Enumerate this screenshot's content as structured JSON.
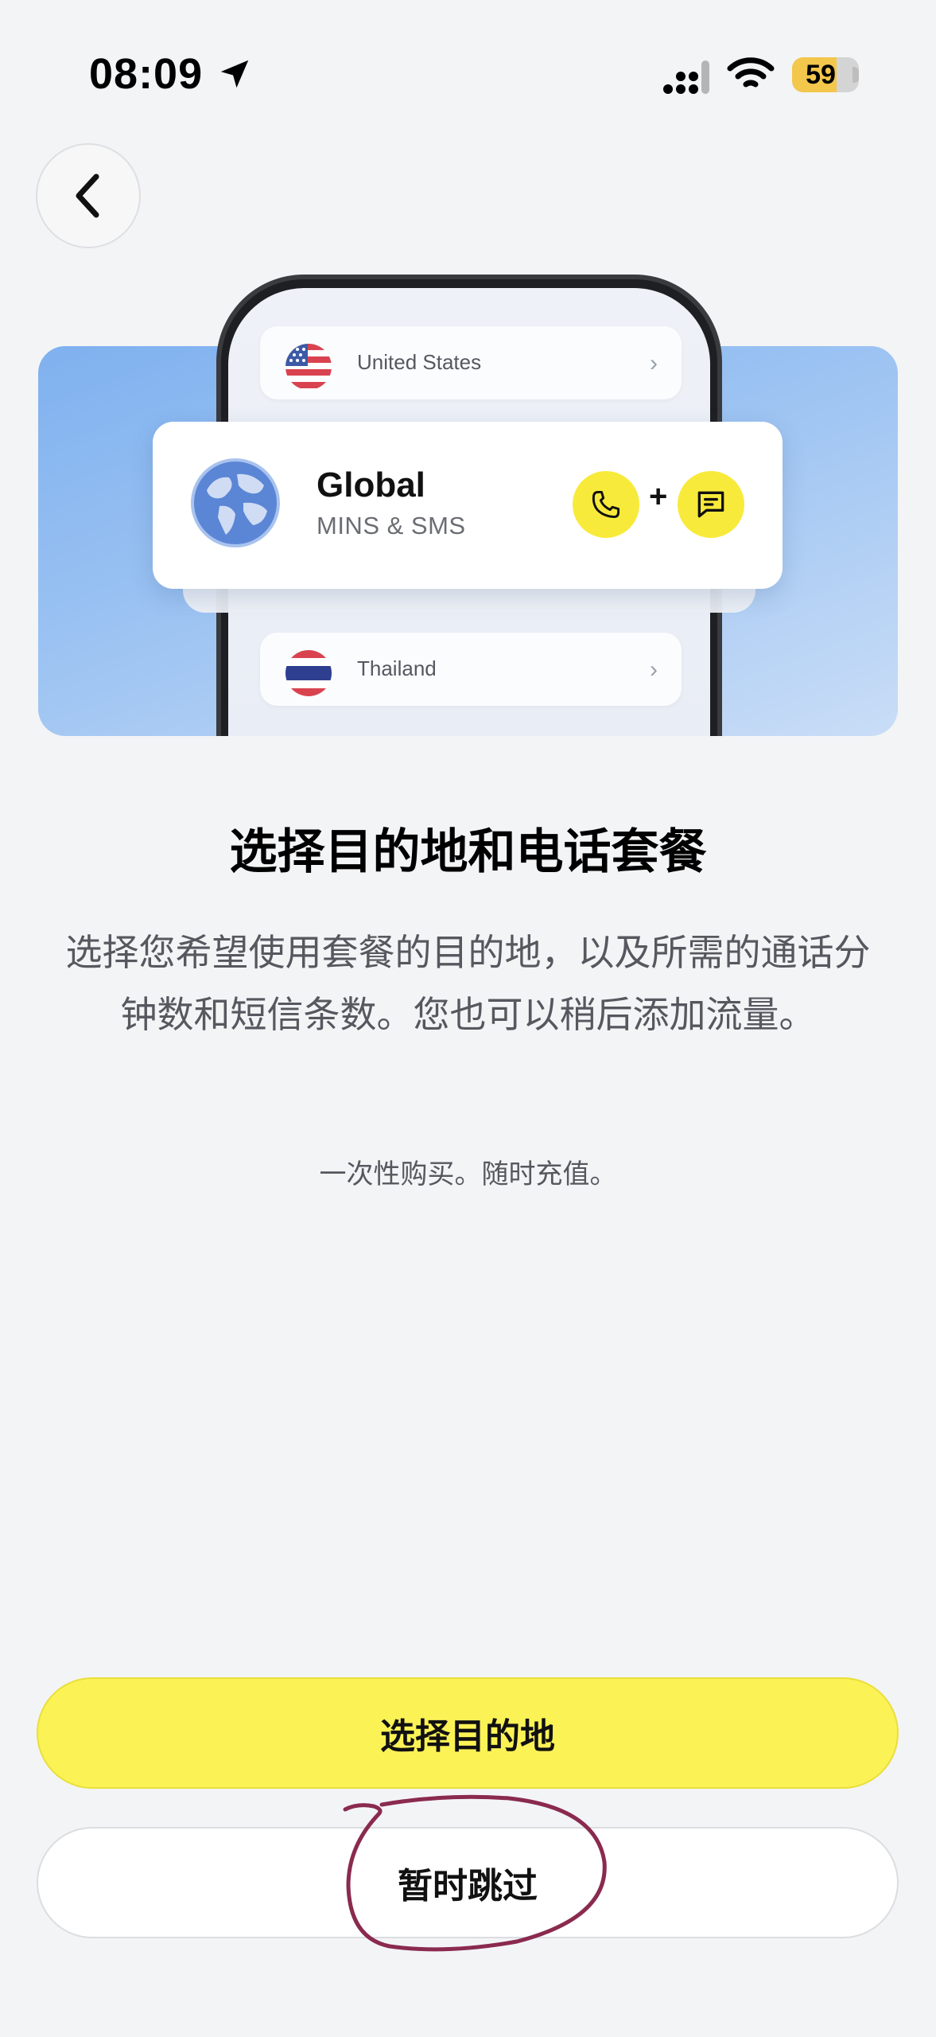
{
  "status_bar": {
    "time": "08:09",
    "battery_level": "59"
  },
  "hero": {
    "top_country": "United States",
    "bottom_country": "Thailand",
    "card_title": "Global",
    "card_subtitle": "MINS & SMS",
    "plus": "+"
  },
  "content": {
    "title": "选择目的地和电话套餐",
    "description": "选择您希望使用套餐的目的地，以及所需的通话分钟数和短信条数。您也可以稍后添加流量。",
    "note": "一次性购买。随时充值。"
  },
  "buttons": {
    "primary_label": "选择目的地",
    "secondary_label": "暂时跳过"
  },
  "colors": {
    "accent_yellow": "#fbf256",
    "background": "#f3f4f6",
    "annotation": "#8a2a4e"
  }
}
